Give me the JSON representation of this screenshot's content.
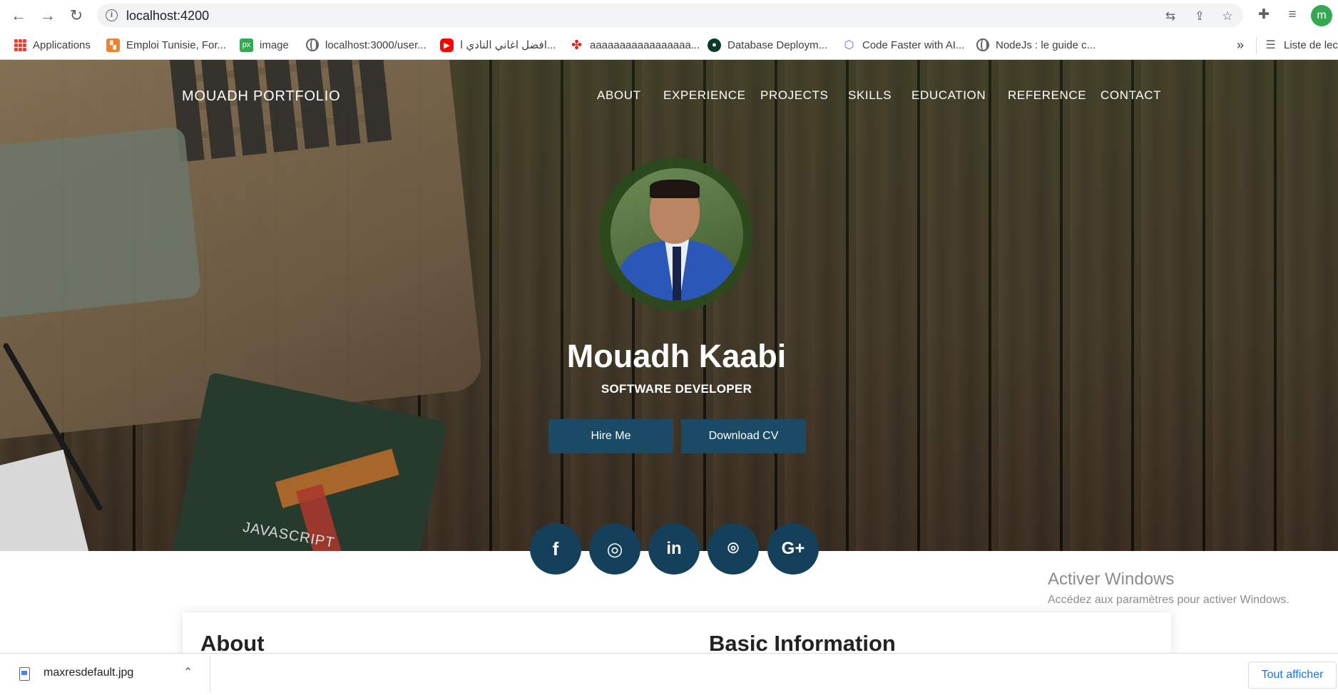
{
  "browser": {
    "url": "localhost:4200",
    "bookmarks": [
      {
        "label": "Applications",
        "icon": "apps-grid-icon"
      },
      {
        "label": "Emploi Tunisie, For...",
        "icon": "emploi-icon"
      },
      {
        "label": "image",
        "icon": "px-icon"
      },
      {
        "label": "localhost:3000/user...",
        "icon": "globe-icon"
      },
      {
        "label": "افضل اغاني النادي ا...",
        "icon": "youtube-icon"
      },
      {
        "label": "aaaaaaaaaaaaaaaaa...",
        "icon": "maple-leaf-icon"
      },
      {
        "label": "Database Deploym...",
        "icon": "mongodb-icon"
      },
      {
        "label": "Code Faster with AI...",
        "icon": "codeium-icon"
      },
      {
        "label": "NodeJs : le guide c...",
        "icon": "globe-icon"
      }
    ],
    "more": "»",
    "reading_list": "Liste de lec",
    "profile_initial": "m",
    "profile_color": "#34a853"
  },
  "site": {
    "brand": "MOUADH PORTFOLIO",
    "nav": [
      "ABOUT",
      "EXPERIENCE",
      "PROJECTS",
      "SKILLS",
      "EDUCATION",
      "REFERENCE",
      "CONTACT"
    ],
    "name": "Mouadh Kaabi",
    "role": "SOFTWARE DEVELOPER",
    "hire_label": "Hire Me",
    "cv_label": "Download CV",
    "button_color": "#1a4a66",
    "social_color": "#14405b",
    "socials": [
      {
        "name": "facebook-icon",
        "glyph": "f"
      },
      {
        "name": "instagram-icon",
        "glyph": "◎"
      },
      {
        "name": "linkedin-icon",
        "glyph": "in"
      },
      {
        "name": "github-icon",
        "glyph": "⌾"
      },
      {
        "name": "google-plus-icon",
        "glyph": "G+"
      }
    ],
    "about_heading": "About",
    "basic_info_heading": "Basic Information"
  },
  "windows_watermark": {
    "title": "Activer Windows",
    "subtitle": "Accédez aux paramètres pour activer Windows."
  },
  "downloads": {
    "file": "maxresdefault.jpg",
    "show_all": "Tout afficher"
  }
}
